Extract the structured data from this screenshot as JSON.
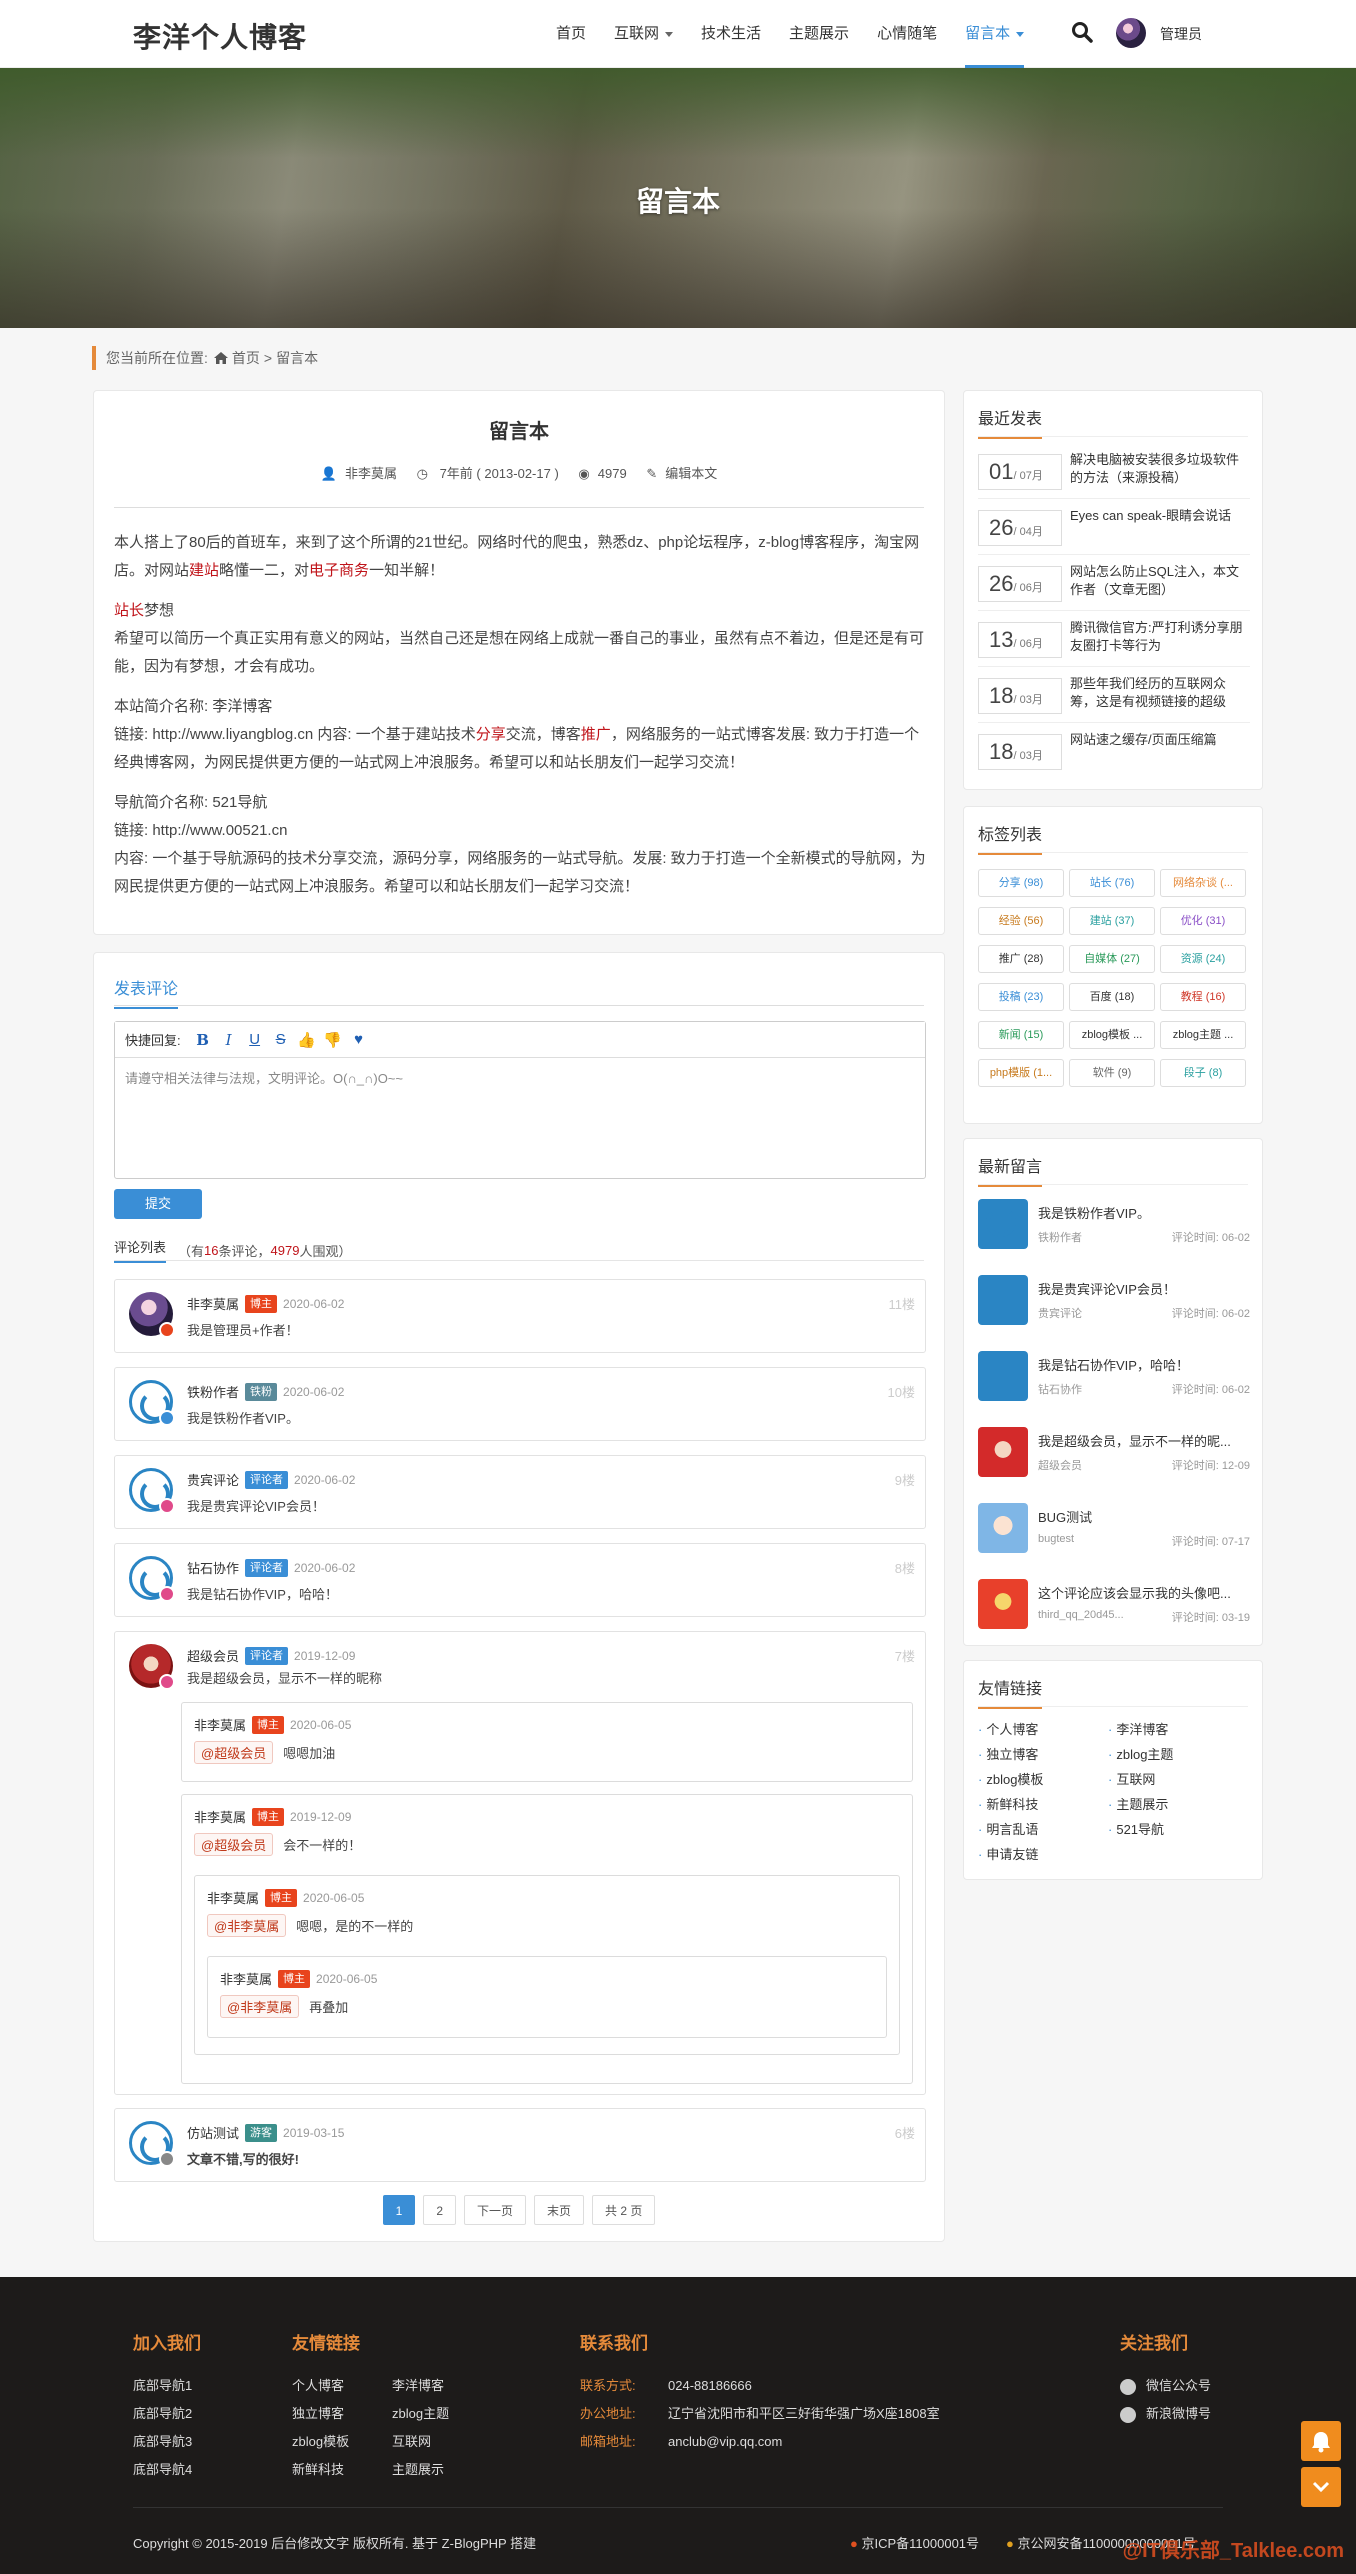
{
  "header": {
    "logo": "李洋个人博客",
    "nav": [
      "首页",
      "互联网",
      "技术生活",
      "主题展示",
      "心情随笔",
      "留言本"
    ],
    "user": "管理员"
  },
  "banner": {
    "title": "留言本"
  },
  "breadcrumb": {
    "prefix": "您当前所在位置:",
    "home": "首页",
    "sep": ">",
    "current": "留言本"
  },
  "article": {
    "title": "留言本",
    "author": "非李莫属",
    "time": "7年前 ( 2013-02-17 )",
    "views": "4979",
    "edit": "编辑本文",
    "p1a": "本人搭上了80后的首班车，来到了这个所谓的21世纪。网络时代的爬虫，熟悉dz、php论坛程序，z-blog博客程序，淘宝网店。对网站",
    "p1b": "建站",
    "p1c": "略懂一二，对",
    "p1d": "电子商务",
    "p1e": "一知半解！",
    "p2a": "站长",
    "p2b": "梦想",
    "p3": "希望可以简历一个真正实用有意义的网站，当然自己还是想在网络上成就一番自己的事业，虽然有点不着边，但是还是有可能，因为有梦想，才会有成功。",
    "p4": "本站简介名称: 李洋博客",
    "p5a": "链接: http://www.liyangblog.cn 内容: 一个基于建站技术",
    "p5b": "分享",
    "p5c": "交流，博客",
    "p5d": "推广",
    "p5e": "，网络服务的一站式博客发展: 致力于打造一个经典博客网，为网民提供更方便的一站式网上冲浪服务。希望可以和站长朋友们一起学习交流！",
    "p6": "导航简介名称: 521导航",
    "p7": "链接: http://www.00521.cn",
    "p8": "内容: 一个基于导航源码的技术分享交流，源码分享，网络服务的一站式导航。发展: 致力于打造一个全新模式的导航网，为网民提供更方便的一站式网上冲浪服务。希望可以和站长朋友们一起学习交流！"
  },
  "comment_form": {
    "title": "发表评论",
    "quick": "快捷回复:",
    "placeholder": "请遵守相关法律与法规，文明评论。O(∩_∩)O~~",
    "submit": "提交"
  },
  "comment_list": {
    "tab": "评论列表",
    "prefix": "（有",
    "count": "16",
    "mid": "条评论，",
    "views": "4979",
    "suffix": "人围观）"
  },
  "comments": [
    {
      "name": "非李莫属",
      "tag": "博主",
      "date": "2020-06-02",
      "floor": "11楼",
      "text": "我是管理员+作者！"
    },
    {
      "name": "铁粉作者",
      "tag": "铁粉",
      "date": "2020-06-02",
      "floor": "10楼",
      "text": "我是铁粉作者VIP。"
    },
    {
      "name": "贵宾评论",
      "tag": "评论者",
      "date": "2020-06-02",
      "floor": "9楼",
      "text": "我是贵宾评论VIP会员！"
    },
    {
      "name": "钻石协作",
      "tag": "评论者",
      "date": "2020-06-02",
      "floor": "8楼",
      "text": "我是钻石协作VIP，哈哈！"
    },
    {
      "name": "超级会员",
      "tag": "评论者",
      "date": "2019-12-09",
      "floor": "7楼",
      "text": "我是超级会员，显示不一样的昵称"
    },
    {
      "name": "仿站测试",
      "tag": "游客",
      "date": "2019-03-15",
      "floor": "6楼",
      "text": "文章不错,写的很好!"
    }
  ],
  "replies": [
    {
      "name": "非李莫属",
      "tag": "博主",
      "date": "2020-06-05",
      "at": "@超级会员",
      "text": "嗯嗯加油"
    },
    {
      "name": "非李莫属",
      "tag": "博主",
      "date": "2019-12-09",
      "at": "@超级会员",
      "text": "会不一样的！"
    },
    {
      "name": "非李莫属",
      "tag": "博主",
      "date": "2020-06-05",
      "at": "@非李莫属",
      "text": "嗯嗯，是的不一样的"
    },
    {
      "name": "非李莫属",
      "tag": "博主",
      "date": "2020-06-05",
      "at": "@非李莫属",
      "text": "再叠加"
    }
  ],
  "pager": [
    "1",
    "2",
    "下一页",
    "末页",
    "共 2 页"
  ],
  "sidebar": {
    "recent_title": "最近发表",
    "recent": [
      {
        "day": "01",
        "month": "/ 07月",
        "title": "解决电脑被安装很多垃圾软件的方法（来源投稿）"
      },
      {
        "day": "26",
        "month": "/ 04月",
        "title": "Eyes can speak-眼睛会说话"
      },
      {
        "day": "26",
        "month": "/ 06月",
        "title": "网站怎么防止SQL注入，本文作者（文章无图）"
      },
      {
        "day": "13",
        "month": "/ 06月",
        "title": "腾讯微信官方:严打利诱分享朋友圈打卡等行为"
      },
      {
        "day": "18",
        "month": "/ 03月",
        "title": "那些年我们经历的互联网众筹，这是有视频链接的超级"
      },
      {
        "day": "18",
        "month": "/ 03月",
        "title": "网站速之缓存/页面压缩篇"
      }
    ],
    "tags_title": "标签列表",
    "tags": [
      {
        "t": "分享 (98)",
        "c": "#3a8ed6"
      },
      {
        "t": "站长 (76)",
        "c": "#3a8ed6"
      },
      {
        "t": "网络杂谈 (...",
        "c": "#e58a3a"
      },
      {
        "t": "经验 (56)",
        "c": "#c77a1d"
      },
      {
        "t": "建站 (37)",
        "c": "#2aa0a0"
      },
      {
        "t": "优化 (31)",
        "c": "#8a4fc7"
      },
      {
        "t": "推广 (28)",
        "c": "#333333"
      },
      {
        "t": "自媒体 (27)",
        "c": "#2a9a5a"
      },
      {
        "t": "资源 (24)",
        "c": "#2aa0a0"
      },
      {
        "t": "投稿 (23)",
        "c": "#3a8ed6"
      },
      {
        "t": "百度 (18)",
        "c": "#333333"
      },
      {
        "t": "教程 (16)",
        "c": "#d0382a"
      },
      {
        "t": "新闻 (15)",
        "c": "#2a9a5a"
      },
      {
        "t": "zblog模板 ...",
        "c": "#333333"
      },
      {
        "t": "zblog主题 ...",
        "c": "#333333"
      },
      {
        "t": "php模版 (1...",
        "c": "#c77a1d"
      },
      {
        "t": "软件 (9)",
        "c": "#666666"
      },
      {
        "t": "段子 (8)",
        "c": "#2aa0a0"
      }
    ],
    "msgs_title": "最新留言",
    "msgs": [
      {
        "text": "我是铁粉作者VIP。",
        "user": "铁粉作者",
        "time": "评论时间: 06-02"
      },
      {
        "text": "我是贵宾评论VIP会员！",
        "user": "贵宾评论",
        "time": "评论时间: 06-02"
      },
      {
        "text": "我是钻石协作VIP，哈哈！",
        "user": "钻石协作",
        "time": "评论时间: 06-02"
      },
      {
        "text": "我是超级会员，显示不一样的昵...",
        "user": "超级会员",
        "time": "评论时间: 12-09"
      },
      {
        "text": "BUG测试",
        "user": "bugtest",
        "time": "评论时间: 07-17"
      },
      {
        "text": "这个评论应该会显示我的头像吧...",
        "user": "third_qq_20d45...",
        "time": "评论时间: 03-19"
      }
    ],
    "links_title": "友情链接",
    "links": [
      "个人博客",
      "李洋博客",
      "独立博客",
      "zblog主题",
      "zblog模板",
      "互联网",
      "新鲜科技",
      "主题展示",
      "明言乱语",
      "521导航",
      "申请友链"
    ]
  },
  "footer": {
    "join_title": "加入我们",
    "join": [
      "底部导航1",
      "底部导航2",
      "底部导航3",
      "底部导航4"
    ],
    "links_title": "友情链接",
    "links": [
      "个人博客",
      "李洋博客",
      "独立博客",
      "zblog主题",
      "zblog模板",
      "互联网",
      "新鲜科技",
      "主题展示"
    ],
    "contact_title": "联系我们",
    "contact": [
      {
        "k": "联系方式:",
        "v": "024-88186666"
      },
      {
        "k": "办公地址:",
        "v": "辽宁省沈阳市和平区三好街华强广场X座1808室"
      },
      {
        "k": "邮箱地址:",
        "v": "anclub@vip.qq.com"
      }
    ],
    "follow_title": "关注我们",
    "follow": [
      "微信公众号",
      "新浪微博号"
    ],
    "copyright": "Copyright © 2015-2019 后台修改文字 版权所有. 基于 Z-BlogPHP 搭建",
    "icp": "京ICP备11000001号",
    "gongan": "京公网安备11000000000001号"
  },
  "watermark": "@IT俱乐部_Talklee.com",
  "colors": {
    "accent": "#3a8ed6",
    "orange": "#e58a3a",
    "host_tag": "#e8441d",
    "footer_bg": "#1d1b1a"
  }
}
